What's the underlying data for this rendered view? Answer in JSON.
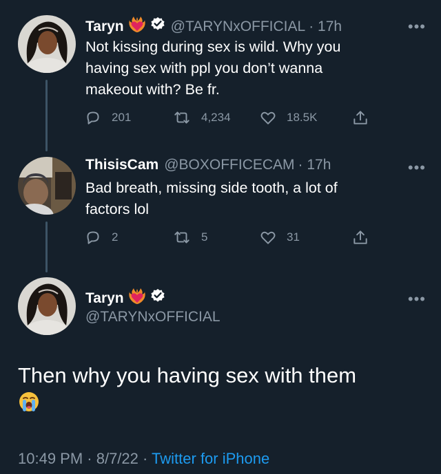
{
  "tweet1": {
    "name": "Taryn",
    "handle": "@TARYNxOFFICIAL",
    "time": "· 17h",
    "text_line1": "Not kissing during sex is wild. Why you",
    "text_line2": "having sex with ppl you don’t wanna",
    "text_line3": "makeout with? Be fr.",
    "replies": "201",
    "retweets": "4,234",
    "likes": "18.5K"
  },
  "tweet2": {
    "name": "ThisisCam",
    "handle": "@BOXOFFICECAM",
    "time": "· 17h",
    "text_line1": "Bad breath, missing side tooth, a lot of",
    "text_line2": "factors lol",
    "replies": "2",
    "retweets": "5",
    "likes": "31"
  },
  "tweet3": {
    "name": "Taryn",
    "handle": "@TARYNxOFFICIAL",
    "text": "Then why you having sex with them",
    "timestamp": "10:49 PM · 8/7/22 · ",
    "source": "Twitter for iPhone"
  },
  "icons": {
    "emoji_heart": "heart-on-fire-emoji",
    "verified": "verified-badge-icon",
    "reply": "reply-icon",
    "retweet": "retweet-icon",
    "like": "like-icon",
    "share": "share-icon",
    "more": "more-icon",
    "crying": "loudly-crying-face-emoji"
  },
  "colors": {
    "background": "#15202b",
    "muted": "#8b98a5",
    "accent": "#1d9bf0",
    "thread_line": "#3d5466"
  }
}
